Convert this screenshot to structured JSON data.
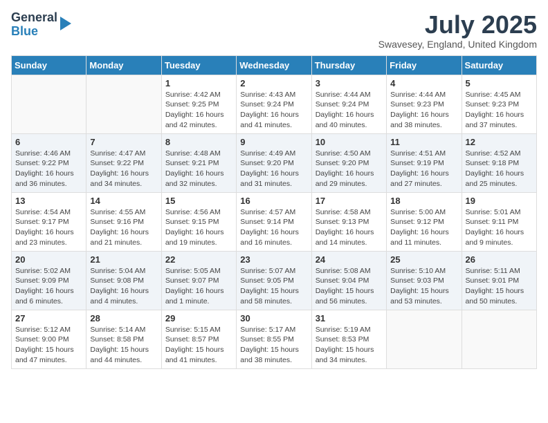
{
  "header": {
    "logo_general": "General",
    "logo_blue": "Blue",
    "month_title": "July 2025",
    "location": "Swavesey, England, United Kingdom"
  },
  "weekdays": [
    "Sunday",
    "Monday",
    "Tuesday",
    "Wednesday",
    "Thursday",
    "Friday",
    "Saturday"
  ],
  "weeks": [
    [
      {
        "day": "",
        "sunrise": "",
        "sunset": "",
        "daylight": ""
      },
      {
        "day": "",
        "sunrise": "",
        "sunset": "",
        "daylight": ""
      },
      {
        "day": "1",
        "sunrise": "Sunrise: 4:42 AM",
        "sunset": "Sunset: 9:25 PM",
        "daylight": "Daylight: 16 hours and 42 minutes."
      },
      {
        "day": "2",
        "sunrise": "Sunrise: 4:43 AM",
        "sunset": "Sunset: 9:24 PM",
        "daylight": "Daylight: 16 hours and 41 minutes."
      },
      {
        "day": "3",
        "sunrise": "Sunrise: 4:44 AM",
        "sunset": "Sunset: 9:24 PM",
        "daylight": "Daylight: 16 hours and 40 minutes."
      },
      {
        "day": "4",
        "sunrise": "Sunrise: 4:44 AM",
        "sunset": "Sunset: 9:23 PM",
        "daylight": "Daylight: 16 hours and 38 minutes."
      },
      {
        "day": "5",
        "sunrise": "Sunrise: 4:45 AM",
        "sunset": "Sunset: 9:23 PM",
        "daylight": "Daylight: 16 hours and 37 minutes."
      }
    ],
    [
      {
        "day": "6",
        "sunrise": "Sunrise: 4:46 AM",
        "sunset": "Sunset: 9:22 PM",
        "daylight": "Daylight: 16 hours and 36 minutes."
      },
      {
        "day": "7",
        "sunrise": "Sunrise: 4:47 AM",
        "sunset": "Sunset: 9:22 PM",
        "daylight": "Daylight: 16 hours and 34 minutes."
      },
      {
        "day": "8",
        "sunrise": "Sunrise: 4:48 AM",
        "sunset": "Sunset: 9:21 PM",
        "daylight": "Daylight: 16 hours and 32 minutes."
      },
      {
        "day": "9",
        "sunrise": "Sunrise: 4:49 AM",
        "sunset": "Sunset: 9:20 PM",
        "daylight": "Daylight: 16 hours and 31 minutes."
      },
      {
        "day": "10",
        "sunrise": "Sunrise: 4:50 AM",
        "sunset": "Sunset: 9:20 PM",
        "daylight": "Daylight: 16 hours and 29 minutes."
      },
      {
        "day": "11",
        "sunrise": "Sunrise: 4:51 AM",
        "sunset": "Sunset: 9:19 PM",
        "daylight": "Daylight: 16 hours and 27 minutes."
      },
      {
        "day": "12",
        "sunrise": "Sunrise: 4:52 AM",
        "sunset": "Sunset: 9:18 PM",
        "daylight": "Daylight: 16 hours and 25 minutes."
      }
    ],
    [
      {
        "day": "13",
        "sunrise": "Sunrise: 4:54 AM",
        "sunset": "Sunset: 9:17 PM",
        "daylight": "Daylight: 16 hours and 23 minutes."
      },
      {
        "day": "14",
        "sunrise": "Sunrise: 4:55 AM",
        "sunset": "Sunset: 9:16 PM",
        "daylight": "Daylight: 16 hours and 21 minutes."
      },
      {
        "day": "15",
        "sunrise": "Sunrise: 4:56 AM",
        "sunset": "Sunset: 9:15 PM",
        "daylight": "Daylight: 16 hours and 19 minutes."
      },
      {
        "day": "16",
        "sunrise": "Sunrise: 4:57 AM",
        "sunset": "Sunset: 9:14 PM",
        "daylight": "Daylight: 16 hours and 16 minutes."
      },
      {
        "day": "17",
        "sunrise": "Sunrise: 4:58 AM",
        "sunset": "Sunset: 9:13 PM",
        "daylight": "Daylight: 16 hours and 14 minutes."
      },
      {
        "day": "18",
        "sunrise": "Sunrise: 5:00 AM",
        "sunset": "Sunset: 9:12 PM",
        "daylight": "Daylight: 16 hours and 11 minutes."
      },
      {
        "day": "19",
        "sunrise": "Sunrise: 5:01 AM",
        "sunset": "Sunset: 9:11 PM",
        "daylight": "Daylight: 16 hours and 9 minutes."
      }
    ],
    [
      {
        "day": "20",
        "sunrise": "Sunrise: 5:02 AM",
        "sunset": "Sunset: 9:09 PM",
        "daylight": "Daylight: 16 hours and 6 minutes."
      },
      {
        "day": "21",
        "sunrise": "Sunrise: 5:04 AM",
        "sunset": "Sunset: 9:08 PM",
        "daylight": "Daylight: 16 hours and 4 minutes."
      },
      {
        "day": "22",
        "sunrise": "Sunrise: 5:05 AM",
        "sunset": "Sunset: 9:07 PM",
        "daylight": "Daylight: 16 hours and 1 minute."
      },
      {
        "day": "23",
        "sunrise": "Sunrise: 5:07 AM",
        "sunset": "Sunset: 9:05 PM",
        "daylight": "Daylight: 15 hours and 58 minutes."
      },
      {
        "day": "24",
        "sunrise": "Sunrise: 5:08 AM",
        "sunset": "Sunset: 9:04 PM",
        "daylight": "Daylight: 15 hours and 56 minutes."
      },
      {
        "day": "25",
        "sunrise": "Sunrise: 5:10 AM",
        "sunset": "Sunset: 9:03 PM",
        "daylight": "Daylight: 15 hours and 53 minutes."
      },
      {
        "day": "26",
        "sunrise": "Sunrise: 5:11 AM",
        "sunset": "Sunset: 9:01 PM",
        "daylight": "Daylight: 15 hours and 50 minutes."
      }
    ],
    [
      {
        "day": "27",
        "sunrise": "Sunrise: 5:12 AM",
        "sunset": "Sunset: 9:00 PM",
        "daylight": "Daylight: 15 hours and 47 minutes."
      },
      {
        "day": "28",
        "sunrise": "Sunrise: 5:14 AM",
        "sunset": "Sunset: 8:58 PM",
        "daylight": "Daylight: 15 hours and 44 minutes."
      },
      {
        "day": "29",
        "sunrise": "Sunrise: 5:15 AM",
        "sunset": "Sunset: 8:57 PM",
        "daylight": "Daylight: 15 hours and 41 minutes."
      },
      {
        "day": "30",
        "sunrise": "Sunrise: 5:17 AM",
        "sunset": "Sunset: 8:55 PM",
        "daylight": "Daylight: 15 hours and 38 minutes."
      },
      {
        "day": "31",
        "sunrise": "Sunrise: 5:19 AM",
        "sunset": "Sunset: 8:53 PM",
        "daylight": "Daylight: 15 hours and 34 minutes."
      },
      {
        "day": "",
        "sunrise": "",
        "sunset": "",
        "daylight": ""
      },
      {
        "day": "",
        "sunrise": "",
        "sunset": "",
        "daylight": ""
      }
    ]
  ]
}
